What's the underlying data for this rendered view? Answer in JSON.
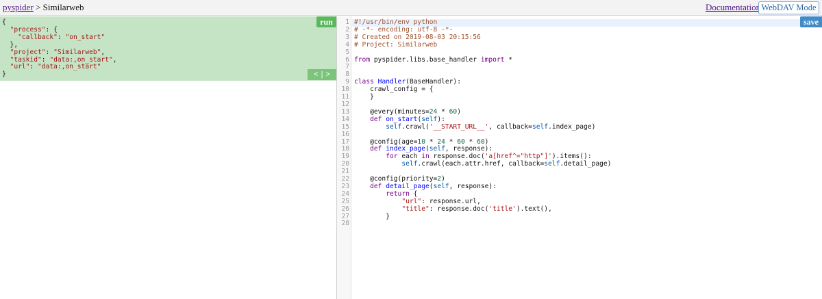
{
  "header": {
    "breadcrumb_root": "pyspider",
    "breadcrumb_sep": ">",
    "project_name": "Similarweb",
    "documentation_label": "Documentation",
    "webdav_label": "WebDAV Mode"
  },
  "task_panel": {
    "run_label": "run",
    "pager_prev": "<",
    "pager_divider": "|",
    "pager_next": ">",
    "json_lines": [
      "{",
      "  \"process\": {",
      "    \"callback\": \"on_start\"",
      "  },",
      "  \"project\": \"Similarweb\",",
      "  \"taskid\": \"data:,on_start\",",
      "  \"url\": \"data:,on_start\"",
      "}"
    ]
  },
  "editor": {
    "save_label": "save",
    "lines": [
      "#!/usr/bin/env python",
      "# -*- encoding: utf-8 -*-",
      "# Created on 2019-08-03 20:15:56",
      "# Project: Similarweb",
      "",
      "from pyspider.libs.base_handler import *",
      "",
      "",
      "class Handler(BaseHandler):",
      "    crawl_config = {",
      "    }",
      "",
      "    @every(minutes=24 * 60)",
      "    def on_start(self):",
      "        self.crawl('__START_URL__', callback=self.index_page)",
      "",
      "    @config(age=10 * 24 * 60 * 60)",
      "    def index_page(self, response):",
      "        for each in response.doc('a[href^=\"http\"]').items():",
      "            self.crawl(each.attr.href, callback=self.detail_page)",
      "",
      "    @config(priority=2)",
      "    def detail_page(self, response):",
      "        return {",
      "            \"url\": response.url,",
      "            \"title\": response.doc('title').text(),",
      "        }",
      ""
    ]
  }
}
